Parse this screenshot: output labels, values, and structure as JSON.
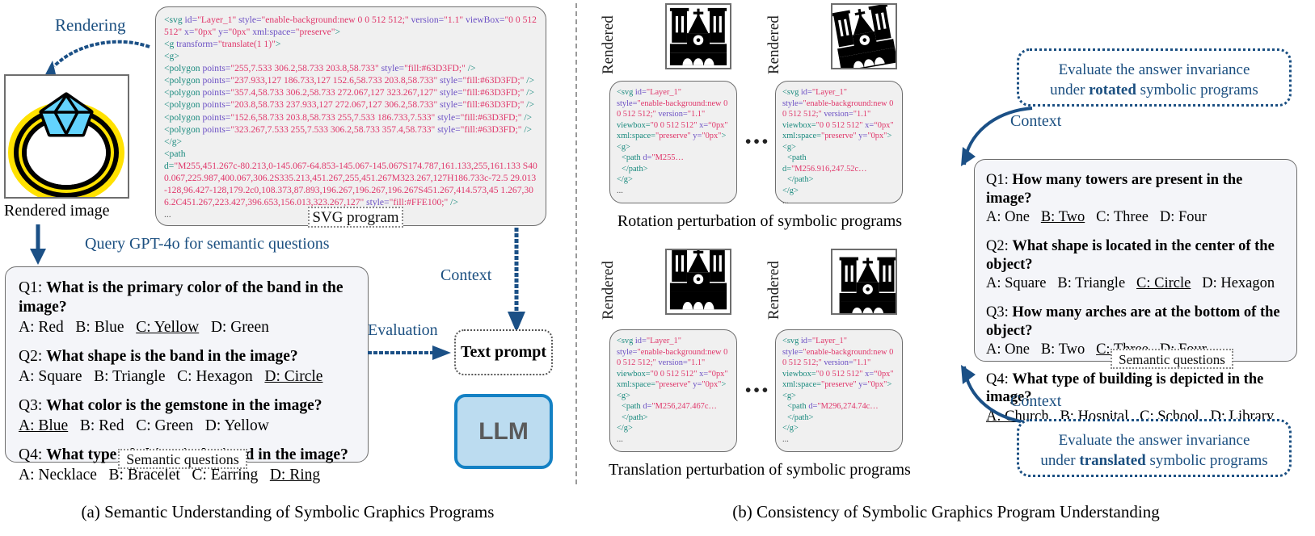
{
  "figure": {
    "panel_a_caption": "(a) Semantic Understanding of Symbolic Graphics Programs",
    "panel_b_caption": "(b) Consistency of Symbolic Graphics Program Understanding"
  },
  "panel_a": {
    "rendering_label": "Rendering",
    "rendered_image_label": "Rendered image",
    "query_label": "Query GPT-4o for semantic questions",
    "evaluation_label": "Evaluation",
    "context_label": "Context",
    "svg_tag": "SVG program",
    "semantic_tag": "Semantic questions",
    "text_prompt": "Text prompt",
    "llm": "LLM",
    "colors": {
      "gem": "#63D3FD",
      "band": "#FFE100",
      "accent_blue": "#1b4f80",
      "llm_fill": "#bcdcf0",
      "llm_border": "#1481c4"
    },
    "svg_code_lines": [
      "<svg id=\"Layer_1\" style=\"enable-background:new 0 0 512 512;\" version=\"1.1\" viewBox=\"0 0 512 512\" x=\"0px\" y=\"0px\" xml:space=\"preserve\">",
      "<g transform=\"translate(1 1)\">",
      "<g>",
      "<polygon points=\"255,7.533 306.2,58.733 203.8,58.733\" style=\"fill:#63D3FD;\" />",
      "<polygon points=\"237.933,127 186.733,127 152.6,58.733 203.8,58.733\" style=\"fill:#63D3FD;\" />",
      "<polygon points=\"357.4,58.733 306.2,58.733 272.067,127 323.267,127\" style=\"fill:#63D3FD;\" />",
      "<polygon points=\"203.8,58.733 237.933,127 272.067,127 306.2,58.733\" style=\"fill:#63D3FD;\" />",
      "<polygon points=\"152.6,58.733 203.8,58.733 255,7.533 186.733,7.533\" style=\"fill:#63D3FD;\" />",
      "<polygon points=\"323.267,7.533 255,7.533 306.2,58.733 357.4,58.733\" style=\"fill:#63D3FD;\" />",
      "</g>",
      "<path",
      "d=\"M255,451.267c-80.213,0-145.067-64.853-145.067-145.067S174.787,161.133,255,161.133 S400.067,225.987,400.067,306.2S335.213,451.267,255,451.267M323.267,127H186.733c-72.5 29.013-128,96.427-128,179.2c0,108.373,87.893,196.267,196.267,196.267S451.267,414.573,451. 267,306.2C451.267,223.427,396.653,156.013,323.267,127\" style=\"fill:#FFE100;\" />",
      "..."
    ],
    "questions": [
      {
        "num": "Q1:",
        "text": "What is the primary color of the band in the image?",
        "options": [
          {
            "label": "A: Red",
            "correct": false
          },
          {
            "label": "B: Blue",
            "correct": false
          },
          {
            "label": "C: Yellow",
            "correct": true
          },
          {
            "label": "D: Green",
            "correct": false
          }
        ]
      },
      {
        "num": "Q2:",
        "text": "What shape is the band in the image?",
        "options": [
          {
            "label": "A: Square",
            "correct": false
          },
          {
            "label": "B: Triangle",
            "correct": false
          },
          {
            "label": "C: Hexagon",
            "correct": false
          },
          {
            "label": "D: Circle",
            "correct": true
          }
        ]
      },
      {
        "num": "Q3:",
        "text": "What color is the gemstone in the image?",
        "options": [
          {
            "label": "A: Blue",
            "correct": true
          },
          {
            "label": "B: Red",
            "correct": false
          },
          {
            "label": "C: Green",
            "correct": false
          },
          {
            "label": "D: Yellow",
            "correct": false
          }
        ]
      },
      {
        "num": "Q4:",
        "text": "What type of object is depicted in the image?",
        "options": [
          {
            "label": "A: Necklace",
            "correct": false
          },
          {
            "label": "B: Bracelet",
            "correct": false
          },
          {
            "label": "C: Earring",
            "correct": false
          },
          {
            "label": "D: Ring",
            "correct": true
          }
        ]
      }
    ]
  },
  "panel_b": {
    "rendered_label": "Rendered",
    "rotation_caption": "Rotation perturbation of symbolic programs",
    "translation_caption": "Translation perturbation of symbolic programs",
    "context_label": "Context",
    "semantic_tag": "Semantic questions",
    "ellipsis": "•••",
    "callout_rotated": {
      "line1": "Evaluate the answer invariance",
      "line2_pre": "under ",
      "line2_bold": "rotated",
      "line2_post": " symbolic programs"
    },
    "callout_translated": {
      "line1": "Evaluate the answer invariance",
      "line2_pre": "under ",
      "line2_bold": "translated",
      "line2_post": " symbolic programs"
    },
    "code_boxes": [
      {
        "lines": [
          "<svg id=\"Layer_1\"",
          "style=\"enable-background:new 0",
          "0 512 512;\" version=\"1.1\"",
          "viewbox=\"0 0 512 512\" x=“0px\"",
          "xml:space=\"preserve\" y=\"0px\">",
          "<g>",
          "  <path d=\"M255…",
          "  </path>",
          "</g>",
          "..."
        ]
      },
      {
        "lines": [
          "<svg id=\"Layer_1\"",
          "style=\"enable-background:new 0",
          "0 512 512;\" version=\"1.1\"",
          "viewbox=\"0 0 512 512\" x=“0px\"",
          "xml:space=\"preserve\" y=\"0px\">",
          "<g>",
          "  <path",
          "d=\"M256.916,247.52c…",
          "  </path>",
          "</g>",
          "..."
        ]
      },
      {
        "lines": [
          "<svg id=\"Layer_1\"",
          "style=\"enable-background:new 0",
          "0 512 512;\" version=\"1.1\"",
          "viewbox=\"0 0 512 512\" x=“0px\"",
          "xml:space=\"preserve\" y=\"0px\">",
          "<g>",
          "  <path d=\"M256,247.467c…",
          "  </path>",
          "</g>",
          "..."
        ]
      },
      {
        "lines": [
          "<svg id=\"Layer_1\"",
          "style=\"enable-background:new 0",
          "0 512 512;\" version=\"1.1\"",
          "viewbox=\"0 0 512 512\" x=“0px\"",
          "xml:space=\"preserve\" y=\"0px\">",
          "<g>",
          "  <path d=\"M296,274.74c…",
          "  </path>",
          "</g>",
          "..."
        ]
      }
    ],
    "questions": [
      {
        "num": "Q1:",
        "text": "How many towers are present in the image?",
        "options": [
          {
            "label": "A: One",
            "correct": false
          },
          {
            "label": "B: Two",
            "correct": true
          },
          {
            "label": "C: Three",
            "correct": false
          },
          {
            "label": "D: Four",
            "correct": false
          }
        ]
      },
      {
        "num": "Q2:",
        "text": "What shape is located in the center of the object?",
        "options": [
          {
            "label": "A: Square",
            "correct": false
          },
          {
            "label": "B: Triangle",
            "correct": false
          },
          {
            "label": "C: Circle",
            "correct": true
          },
          {
            "label": "D: Hexagon",
            "correct": false
          }
        ]
      },
      {
        "num": "Q3:",
        "text": "How many arches are at the bottom of the object?",
        "options": [
          {
            "label": "A: One",
            "correct": false
          },
          {
            "label": "B: Two",
            "correct": false
          },
          {
            "label": "C: Three",
            "correct": true
          },
          {
            "label": "D: Four",
            "correct": false
          }
        ]
      },
      {
        "num": "Q4:",
        "text": "What type of building is depicted in the image?",
        "options": [
          {
            "label": "A: Church",
            "correct": true
          },
          {
            "label": "B: Hospital",
            "correct": false
          },
          {
            "label": "C: School",
            "correct": false
          },
          {
            "label": "D: Library",
            "correct": false
          }
        ]
      }
    ]
  }
}
